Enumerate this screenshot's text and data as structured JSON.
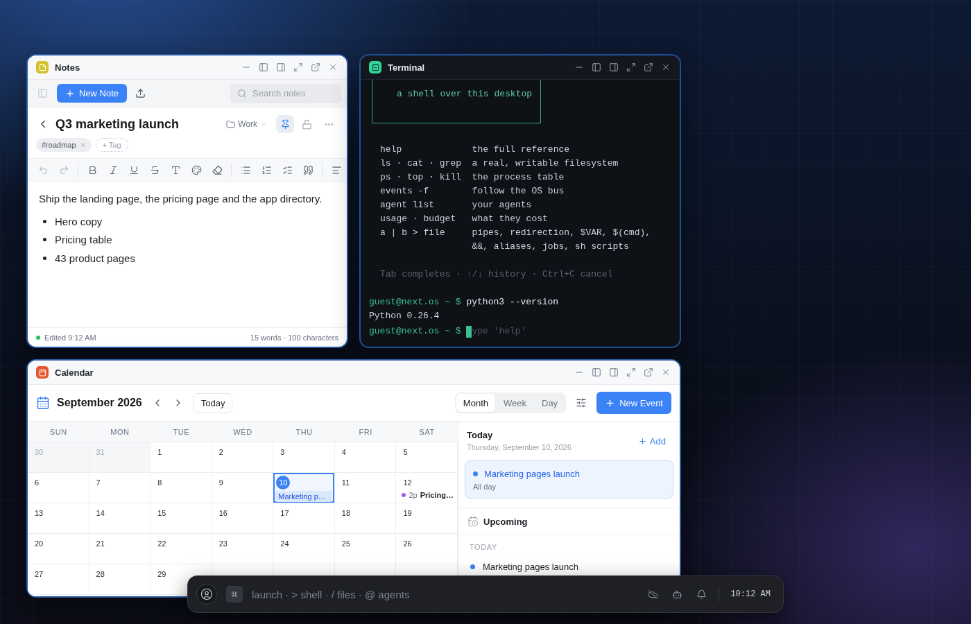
{
  "notes_window": {
    "title": "Notes",
    "toolbar": {
      "new_button": "New Note",
      "search": {
        "placeholder": "Search notes"
      }
    },
    "note": {
      "title": "Q3 marketing launch",
      "folder": "Work",
      "pinned": true,
      "locked": false,
      "tags": [
        {
          "label": "#roadmap"
        }
      ],
      "add_tag": "+ Tag",
      "undo_disabled": true,
      "redo_disabled": true,
      "paragraph": "Ship the landing page, the pricing page and the app directory.",
      "bullets": [
        "Hero copy",
        "Pricing table",
        "43 product pages"
      ]
    },
    "status_bar": {
      "synced": true,
      "edited": "Edited 9:12 AM",
      "counts": "15 words · 100 characters"
    }
  },
  "terminal_window": {
    "title": "Terminal",
    "banner": "a shell over this desktop",
    "commands": [
      {
        "command": "help",
        "description": "the full reference"
      },
      {
        "command": "ls · cat · grep",
        "description": "a real, writable filesystem"
      },
      {
        "command": "ps · top · kill",
        "description": "the process table"
      },
      {
        "command": "events -f",
        "description": "follow the OS bus"
      },
      {
        "command": "agent list",
        "description": "your agents"
      },
      {
        "command": "usage · budget",
        "description": "what they cost"
      },
      {
        "command": "a | b > file",
        "description": "pipes, redirection, $VAR, $(cmd), &&, aliases, jobs, sh scripts"
      }
    ],
    "hint": "Tab completes · ↑/↓ history · Ctrl+C cancel",
    "history": [
      {
        "prompt": "guest@next.os ~ $",
        "input": "python3 --version",
        "output": "Python 0.26.4"
      }
    ],
    "prompt": {
      "prompt": "guest@next.os ~ $",
      "placeholder": "ype 'help'"
    }
  },
  "calendar_window": {
    "title": "Calendar",
    "month": "September 2026",
    "today_button": "Today",
    "views": [
      {
        "label": "Month",
        "selected": true
      },
      {
        "label": "Week",
        "selected": false
      },
      {
        "label": "Day",
        "selected": false
      }
    ],
    "new_button": "New Event",
    "weekdays": [
      "SUN",
      "MON",
      "TUE",
      "WED",
      "THU",
      "FRI",
      "SAT"
    ],
    "weeks": [
      [
        {
          "day": "30",
          "in_month": false,
          "selected": false
        },
        {
          "day": "31",
          "in_month": false,
          "selected": false
        },
        {
          "day": "1",
          "in_month": true,
          "selected": false
        },
        {
          "day": "2",
          "in_month": true,
          "selected": false
        },
        {
          "day": "3",
          "in_month": true,
          "selected": false
        },
        {
          "day": "4",
          "in_month": true,
          "selected": false
        },
        {
          "day": "5",
          "in_month": true,
          "selected": false
        }
      ],
      [
        {
          "day": "6",
          "in_month": true,
          "selected": false
        },
        {
          "day": "7",
          "in_month": true,
          "selected": false
        },
        {
          "day": "8",
          "in_month": true,
          "selected": false
        },
        {
          "day": "9",
          "in_month": true,
          "selected": false
        },
        {
          "day": "10",
          "in_month": true,
          "selected": true,
          "events": [
            {
              "kind": "all_day",
              "title": "Marketing p…"
            }
          ]
        },
        {
          "day": "11",
          "in_month": true,
          "selected": false
        },
        {
          "day": "12",
          "in_month": true,
          "selected": false,
          "events": [
            {
              "kind": "timed",
              "time": "2p",
              "title": "Pricing…",
              "color": "#a855f7"
            }
          ]
        }
      ],
      [
        {
          "day": "13",
          "in_month": true,
          "selected": false
        },
        {
          "day": "14",
          "in_month": true,
          "selected": false
        },
        {
          "day": "15",
          "in_month": true,
          "selected": false
        },
        {
          "day": "16",
          "in_month": true,
          "selected": false
        },
        {
          "day": "17",
          "in_month": true,
          "selected": false
        },
        {
          "day": "18",
          "in_month": true,
          "selected": false
        },
        {
          "day": "19",
          "in_month": true,
          "selected": false
        }
      ],
      [
        {
          "day": "20",
          "in_month": true,
          "selected": false
        },
        {
          "day": "21",
          "in_month": true,
          "selected": false
        },
        {
          "day": "22",
          "in_month": true,
          "selected": false
        },
        {
          "day": "23",
          "in_month": true,
          "selected": false
        },
        {
          "day": "24",
          "in_month": true,
          "selected": false
        },
        {
          "day": "25",
          "in_month": true,
          "selected": false
        },
        {
          "day": "26",
          "in_month": true,
          "selected": false
        }
      ],
      [
        {
          "day": "27",
          "in_month": true,
          "selected": false
        },
        {
          "day": "28",
          "in_month": true,
          "selected": false
        },
        {
          "day": "29",
          "in_month": true,
          "selected": false
        }
      ]
    ],
    "sidebar": {
      "heading": "Today",
      "date": "Thursday, September 10, 2026",
      "add": "Add",
      "today_events": [
        {
          "title": "Marketing pages launch",
          "when": "All day",
          "color": "#3b82f6"
        }
      ],
      "upcoming": {
        "heading": "Upcoming",
        "groups": [
          {
            "label": "TODAY",
            "events": [
              {
                "title": "Marketing pages launch",
                "color": "#3b82f6"
              }
            ]
          }
        ]
      }
    }
  },
  "taskbar": {
    "shortcut_key": "⌘",
    "launcher": {
      "placeholder": "launch · > shell · / files · @ agents"
    },
    "clock": "10:12 AM"
  }
}
